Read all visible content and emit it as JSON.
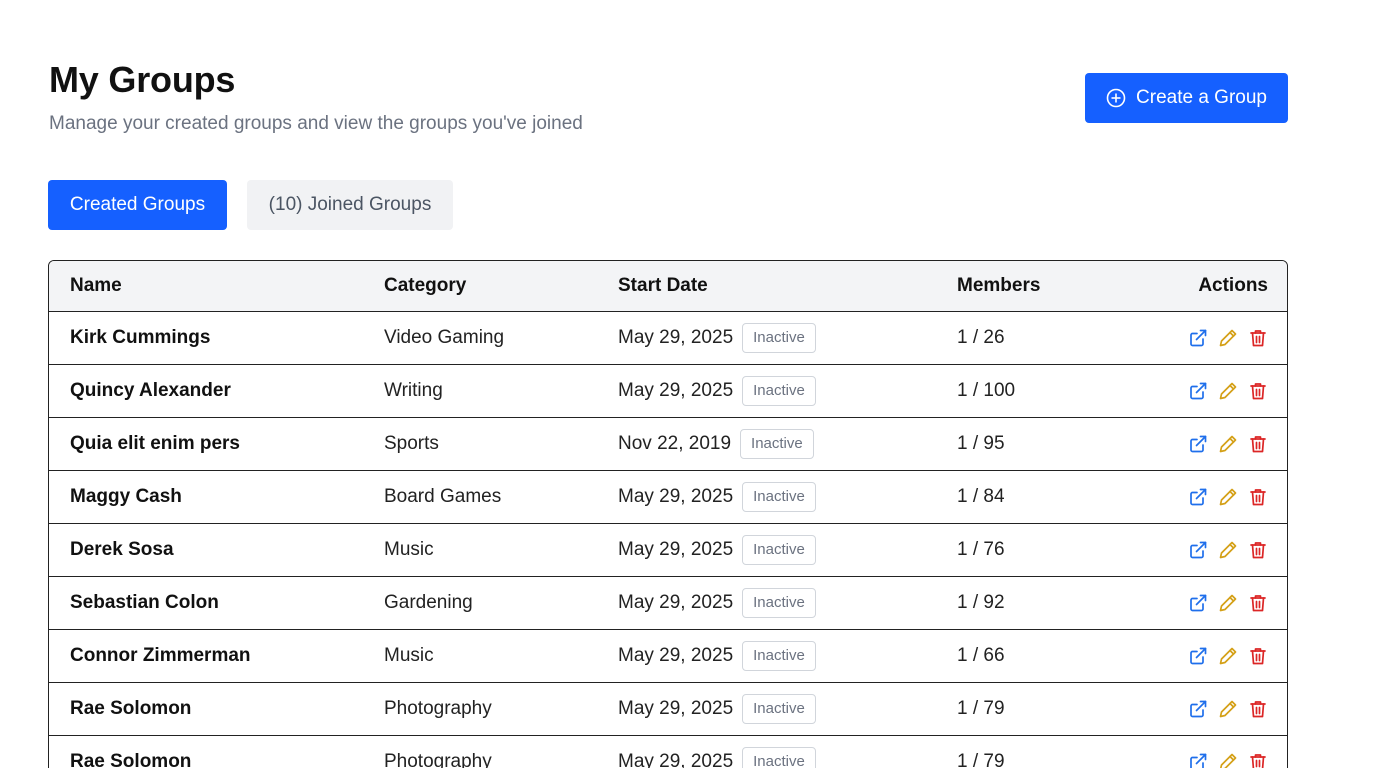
{
  "header": {
    "title": "My Groups",
    "subtitle": "Manage your created groups and view the groups you've joined"
  },
  "create_button": {
    "label": "Create a Group",
    "icon": "plus-circle-icon"
  },
  "tabs": [
    {
      "label": "Created Groups",
      "active": true
    },
    {
      "label": "(10) Joined Groups",
      "active": false
    }
  ],
  "table": {
    "columns": [
      "Name",
      "Category",
      "Start Date",
      "Members",
      "Actions"
    ],
    "rows": [
      {
        "name": "Kirk Cummings",
        "category": "Video Gaming",
        "start_date": "May 29, 2025",
        "status": "Inactive",
        "members": "1 / 26"
      },
      {
        "name": "Quincy Alexander",
        "category": "Writing",
        "start_date": "May 29, 2025",
        "status": "Inactive",
        "members": "1 / 100"
      },
      {
        "name": "Quia elit enim pers",
        "category": "Sports",
        "start_date": "Nov 22, 2019",
        "status": "Inactive",
        "members": "1 / 95"
      },
      {
        "name": "Maggy Cash",
        "category": "Board Games",
        "start_date": "May 29, 2025",
        "status": "Inactive",
        "members": "1 / 84"
      },
      {
        "name": "Derek Sosa",
        "category": "Music",
        "start_date": "May 29, 2025",
        "status": "Inactive",
        "members": "1 / 76"
      },
      {
        "name": "Sebastian Colon",
        "category": "Gardening",
        "start_date": "May 29, 2025",
        "status": "Inactive",
        "members": "1 / 92"
      },
      {
        "name": "Connor Zimmerman",
        "category": "Music",
        "start_date": "May 29, 2025",
        "status": "Inactive",
        "members": "1 / 66"
      },
      {
        "name": "Rae Solomon",
        "category": "Photography",
        "start_date": "May 29, 2025",
        "status": "Inactive",
        "members": "1 / 79"
      },
      {
        "name": "Rae Solomon",
        "category": "Photography",
        "start_date": "May 29, 2025",
        "status": "Inactive",
        "members": "1 / 79"
      }
    ],
    "action_icons": [
      "external-link-icon",
      "pencil-icon",
      "trash-icon"
    ]
  },
  "colors": {
    "primary": "#1560ff",
    "view_icon": "#1f6feb",
    "edit_icon": "#d4a017",
    "delete_icon": "#dc2626"
  }
}
